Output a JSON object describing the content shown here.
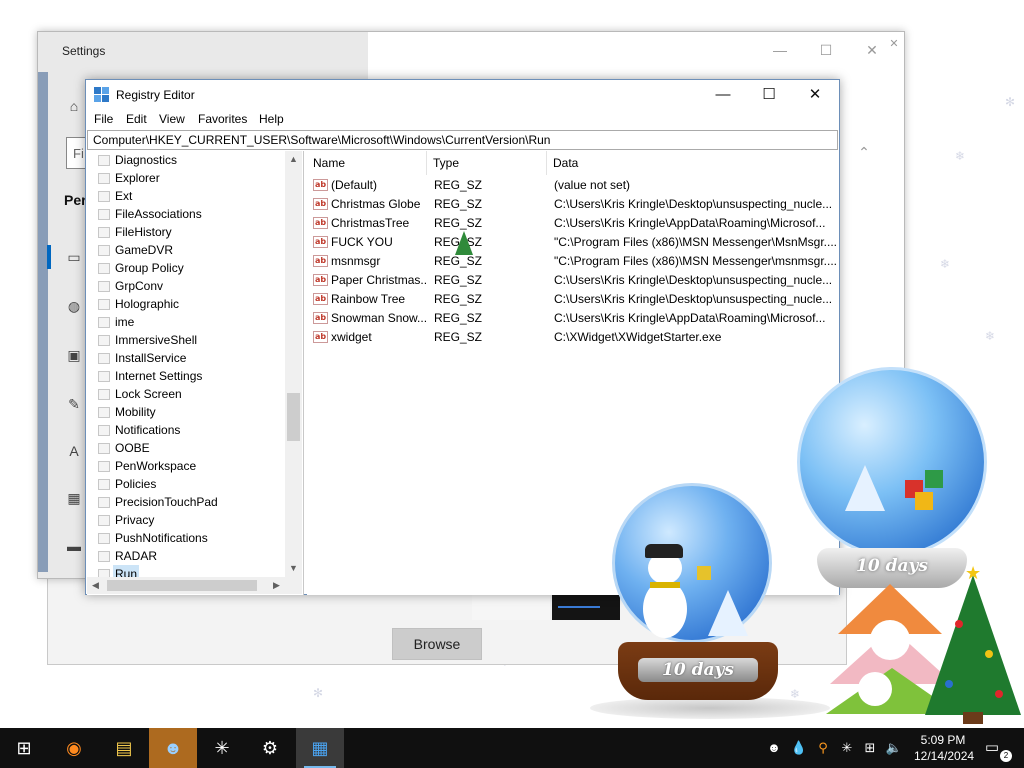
{
  "settings": {
    "title": "Settings",
    "search_placeholder": "Fi",
    "section_label": "Per",
    "browse_label": "Browse"
  },
  "regedit": {
    "title": "Registry Editor",
    "menu": [
      "File",
      "Edit",
      "View",
      "Favorites",
      "Help"
    ],
    "address": "Computer\\HKEY_CURRENT_USER\\Software\\Microsoft\\Windows\\CurrentVersion\\Run",
    "tree": [
      "Diagnostics",
      "Explorer",
      "Ext",
      "FileAssociations",
      "FileHistory",
      "GameDVR",
      "Group Policy",
      "GrpConv",
      "Holographic",
      "ime",
      "ImmersiveShell",
      "InstallService",
      "Internet Settings",
      "Lock Screen",
      "Mobility",
      "Notifications",
      "OOBE",
      "PenWorkspace",
      "Policies",
      "PrecisionTouchPad",
      "Privacy",
      "PushNotifications",
      "RADAR",
      "Run"
    ],
    "selected_key": "Run",
    "columns": {
      "name": "Name",
      "type": "Type",
      "data": "Data"
    },
    "values": [
      {
        "name": "(Default)",
        "type": "REG_SZ",
        "data": "(value not set)"
      },
      {
        "name": "Christmas Globe",
        "type": "REG_SZ",
        "data": "C:\\Users\\Kris Kringle\\Desktop\\unsuspecting_nucle..."
      },
      {
        "name": "ChristmasTree",
        "type": "REG_SZ",
        "data": "C:\\Users\\Kris Kringle\\AppData\\Roaming\\Microsof..."
      },
      {
        "name": "FUCK YOU",
        "type": "REG_SZ",
        "data": "\"C:\\Program Files (x86)\\MSN Messenger\\MsnMsgr...."
      },
      {
        "name": "msnmsgr",
        "type": "REG_SZ",
        "data": "\"C:\\Program Files (x86)\\MSN Messenger\\msnmsgr...."
      },
      {
        "name": "Paper Christmas...",
        "type": "REG_SZ",
        "data": "C:\\Users\\Kris Kringle\\Desktop\\unsuspecting_nucle..."
      },
      {
        "name": "Rainbow Tree",
        "type": "REG_SZ",
        "data": "C:\\Users\\Kris Kringle\\Desktop\\unsuspecting_nucle..."
      },
      {
        "name": "Snowman Snow...",
        "type": "REG_SZ",
        "data": "C:\\Users\\Kris Kringle\\AppData\\Roaming\\Microsof..."
      },
      {
        "name": "xwidget",
        "type": "REG_SZ",
        "data": "C:\\XWidget\\XWidgetStarter.exe"
      }
    ]
  },
  "desktop": {
    "globe_label": "10 days",
    "colors": {
      "globe_blue": "#2a6fcf",
      "base_brown": "#7b3c14",
      "tree_green": "#1f7a2e"
    }
  },
  "taskbar": {
    "apps": [
      {
        "name": "start",
        "icon": "windows-logo-icon",
        "glyph": "⊞"
      },
      {
        "name": "firefox",
        "icon": "firefox-icon",
        "glyph": "◉"
      },
      {
        "name": "file-explorer",
        "icon": "folder-icon",
        "glyph": "▤"
      },
      {
        "name": "people-app",
        "icon": "people-icon",
        "glyph": "☻"
      },
      {
        "name": "snowflake-app",
        "icon": "snowflake-icon",
        "glyph": "✳"
      },
      {
        "name": "settings",
        "icon": "gear-icon",
        "glyph": "⚙"
      },
      {
        "name": "registry-editor",
        "icon": "regedit-icon",
        "glyph": "▦"
      }
    ],
    "time": "5:09 PM",
    "date": "12/14/2024",
    "notification_count": "2"
  }
}
